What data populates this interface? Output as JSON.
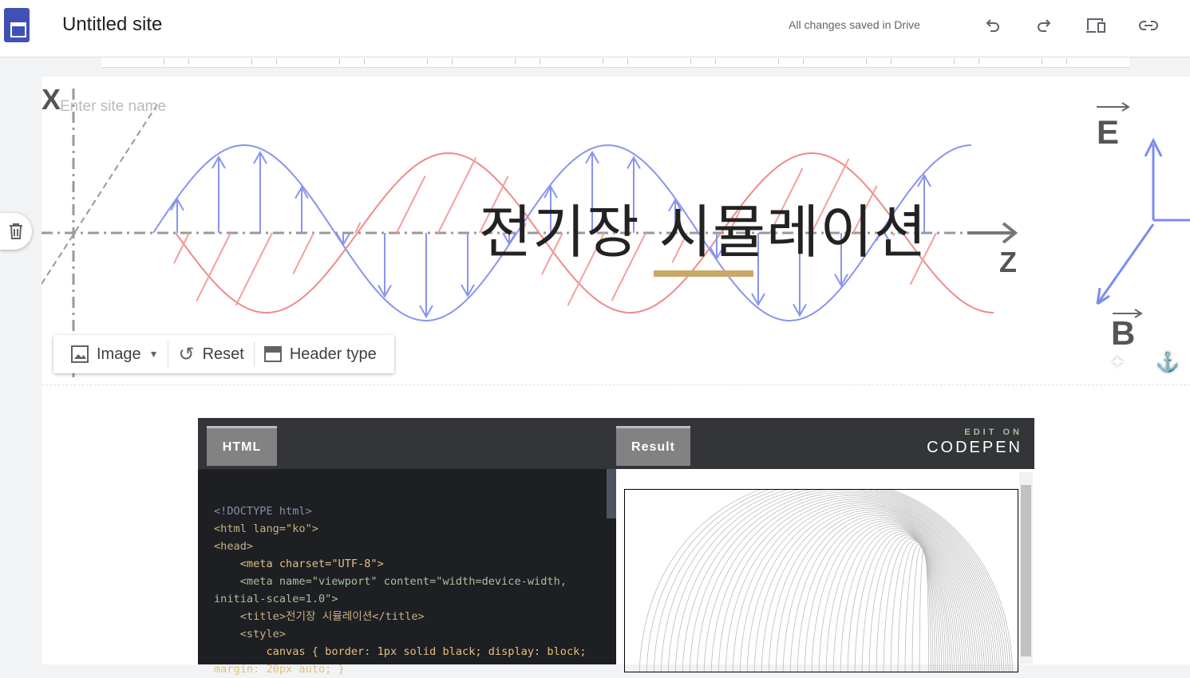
{
  "topbar": {
    "site_title": "Untitled site",
    "save_status": "All changes saved in Drive"
  },
  "hero": {
    "site_name_placeholder": "Enter site name",
    "title": "전기장 시뮬레이션",
    "image_labels": {
      "x": "X",
      "e": "E",
      "z": "Z",
      "b": "B"
    },
    "tools": {
      "image": "Image",
      "reset": "Reset",
      "header_type": "Header type"
    }
  },
  "codepen": {
    "tab_html": "HTML",
    "tab_result": "Result",
    "edit_on": "EDIT ON",
    "brand": "CODEPEN",
    "code_lines": [
      "<!DOCTYPE html>",
      "<html lang=\"ko\">",
      "<head>",
      "    <meta charset=\"UTF-8\">",
      "    <meta name=\"viewport\" content=\"width=device-width, initial-scale=1.0\">",
      "    <title>전기장 시뮬레이션</title>",
      "    <style>",
      "        canvas { border: 1px solid black; display: block; margin: 20px auto; }"
    ]
  },
  "colors": {
    "accent": "#c9a865",
    "sites_blue": "#4050b5",
    "e_wave": "#8a93f0",
    "b_wave": "#f08a8a"
  }
}
